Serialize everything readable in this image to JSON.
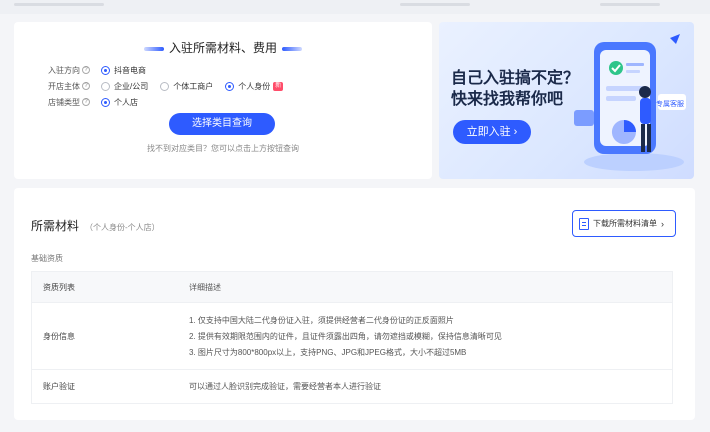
{
  "filter": {
    "title": "入驻所需材料、费用",
    "rows": [
      {
        "label": "入驻方向",
        "options": [
          {
            "text": "抖音电商",
            "selected": true
          }
        ]
      },
      {
        "label": "开店主体",
        "options": [
          {
            "text": "企业/公司",
            "selected": false
          },
          {
            "text": "个体工商户",
            "selected": false
          },
          {
            "text": "个人身份",
            "selected": true,
            "tag": "新"
          }
        ]
      },
      {
        "label": "店铺类型",
        "options": [
          {
            "text": "个人店",
            "selected": true
          }
        ]
      }
    ],
    "search_button": "选择类目查询",
    "hint": "找不到对应类目？您可以点击上方按钮查询"
  },
  "banner": {
    "headline1": "自己入驻搞不定？",
    "headline2": "快来找我帮你吧",
    "cta": "立即入驻",
    "badge": "专属客服"
  },
  "materials": {
    "title": "所需材料",
    "subtitle": "（个人身份-个人店）",
    "download_button": "下载所需材料清单",
    "section_label": "基础资质",
    "columns": [
      "资质列表",
      "详细描述"
    ],
    "rows": [
      {
        "name": "身份信息",
        "details": [
          "1. 仅支持中国大陆二代身份证入驻，须提供经营者二代身份证的正反面照片",
          "2. 提供有效期限范围内的证件，且证件须露出四角，请勿遮挡或模糊，保持信息清晰可见",
          "3. 图片尺寸为800*800px以上，支持PNG、JPG和JPEG格式，大小不超过5MB"
        ]
      },
      {
        "name": "账户验证",
        "details": [
          "可以通过人脸识别完成验证，需要经营者本人进行验证"
        ]
      }
    ]
  },
  "colors": {
    "primary": "#2e5bff",
    "new_tag": "#ff4d6a"
  }
}
